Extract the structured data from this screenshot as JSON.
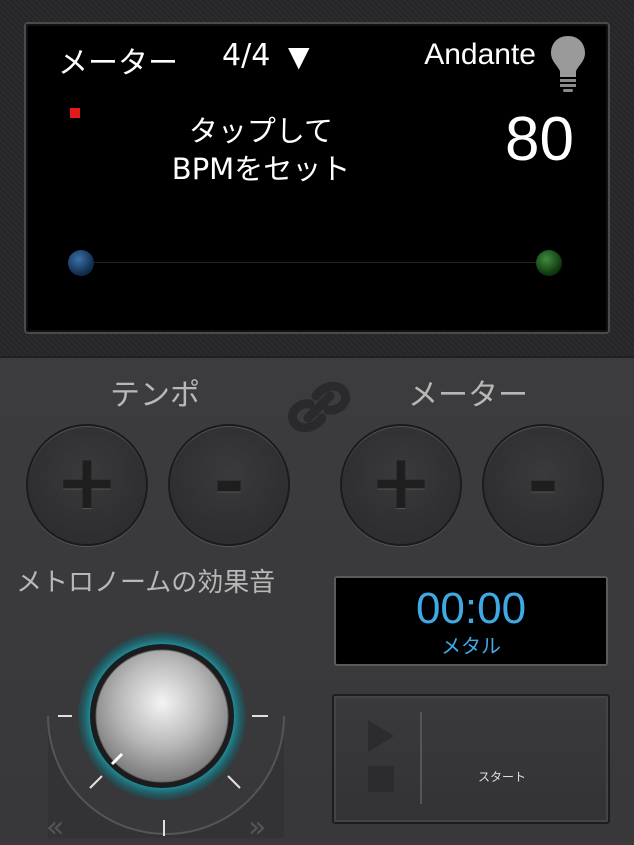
{
  "display": {
    "meter_label": "メーター",
    "meter_value": "4/4",
    "meter_arrow": "▼",
    "tempo_name": "Andante",
    "tap_line1": "タップして",
    "tap_line2": "BPMをセット",
    "bpm": "80",
    "bulb_icon": "light-bulb-icon",
    "beat_color": "#e21a1a"
  },
  "controls": {
    "tempo_label": "テンポ",
    "meter_label": "メーター",
    "tempo_plus": "+",
    "tempo_minus": "-",
    "meter_plus": "+",
    "meter_minus": "-",
    "link_icon": "link-icon"
  },
  "sound": {
    "label": "メトロノームの効果音",
    "dial_accent": "#19c6d6",
    "left_arrow": "«",
    "right_arrow": "»"
  },
  "timer": {
    "time": "00:00",
    "label": "メタル",
    "color": "#3fa9e6"
  },
  "start": {
    "label": "スタート",
    "play_icon": "play-icon",
    "stop_icon": "stop-icon"
  }
}
